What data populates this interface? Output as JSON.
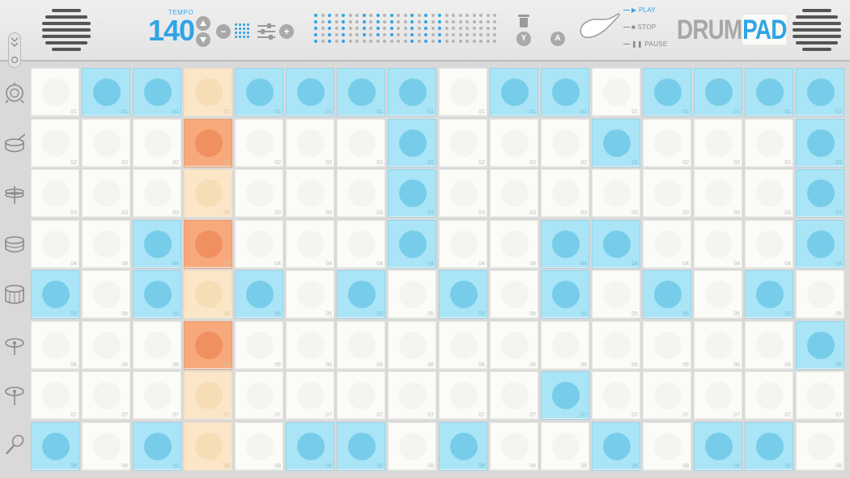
{
  "header": {
    "tempo_label": "TEMPO",
    "tempo_value": "140",
    "minus_label": "−",
    "plus_label": "+",
    "y_button": "Y",
    "a_button": "A",
    "play_label": "PLAY",
    "stop_label": "STOP",
    "pause_label": "PAUSE",
    "brand_part1": "DRUM",
    "brand_part2": "PAD",
    "led_pattern": [
      [
        1,
        0,
        1,
        0,
        0,
        0,
        1,
        0,
        1,
        0,
        1,
        0,
        1,
        0,
        0,
        0,
        1,
        0,
        1,
        0,
        1,
        0,
        0,
        0,
        1,
        0,
        0,
        0,
        1,
        0,
        1,
        0,
        0,
        0,
        0,
        0,
        0,
        0,
        0,
        0,
        0,
        0,
        0,
        0,
        0,
        0,
        0,
        0,
        0,
        0
      ],
      [
        0,
        0,
        0,
        0,
        0,
        0,
        0,
        0,
        0,
        0,
        0,
        0,
        0,
        0,
        0,
        0,
        0,
        0,
        0,
        0,
        0,
        0,
        0,
        0,
        0,
        0,
        0,
        0,
        0,
        0,
        0,
        0,
        0,
        0,
        0,
        0,
        0,
        0,
        0,
        0,
        0,
        0,
        0,
        0,
        0,
        0,
        0,
        0,
        0,
        0
      ]
    ]
  },
  "sidebar": {
    "instruments": [
      "bass-drum",
      "snare-drum",
      "hi-hat",
      "tom",
      "floor-tom",
      "crash",
      "ride",
      "maracas"
    ]
  },
  "grid": {
    "playhead_column": 3,
    "rows": [
      {
        "label": "01",
        "steps": [
          0,
          1,
          1,
          0,
          1,
          1,
          1,
          1,
          0,
          1,
          1,
          0,
          1,
          1,
          1,
          1
        ]
      },
      {
        "label": "02",
        "steps": [
          0,
          0,
          0,
          1,
          0,
          0,
          0,
          1,
          0,
          0,
          0,
          1,
          0,
          0,
          0,
          1
        ]
      },
      {
        "label": "03",
        "steps": [
          0,
          0,
          0,
          0,
          0,
          0,
          0,
          1,
          0,
          0,
          0,
          0,
          0,
          0,
          0,
          1
        ]
      },
      {
        "label": "04",
        "steps": [
          0,
          0,
          1,
          1,
          0,
          0,
          0,
          1,
          0,
          0,
          1,
          1,
          0,
          0,
          0,
          1
        ]
      },
      {
        "label": "05",
        "steps": [
          1,
          0,
          1,
          0,
          1,
          0,
          1,
          0,
          1,
          0,
          1,
          0,
          1,
          0,
          1,
          0
        ]
      },
      {
        "label": "06",
        "steps": [
          0,
          0,
          0,
          1,
          0,
          0,
          0,
          0,
          0,
          0,
          0,
          0,
          0,
          0,
          0,
          1
        ]
      },
      {
        "label": "07",
        "steps": [
          0,
          0,
          0,
          0,
          0,
          0,
          0,
          0,
          0,
          0,
          1,
          0,
          0,
          0,
          0,
          0
        ]
      },
      {
        "label": "08",
        "steps": [
          1,
          0,
          1,
          0,
          0,
          1,
          1,
          0,
          1,
          0,
          0,
          1,
          0,
          1,
          1,
          0
        ]
      }
    ]
  }
}
